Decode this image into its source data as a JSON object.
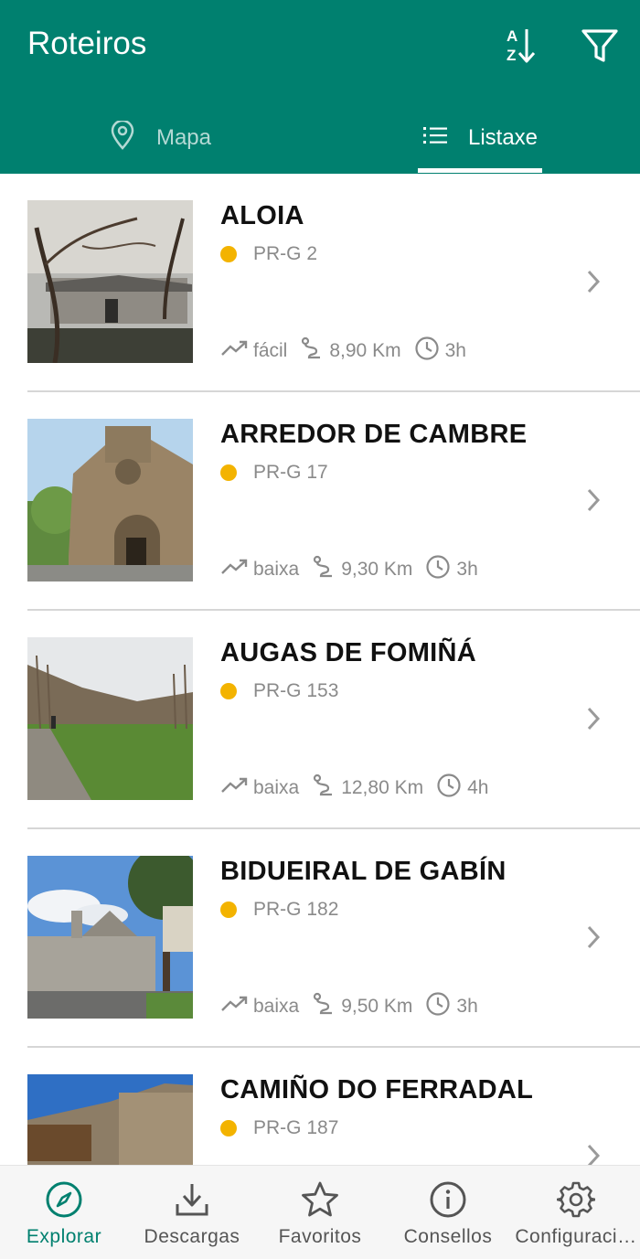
{
  "app": {
    "title": "Roteiros"
  },
  "header": {
    "sort_icon": "sort-alpha-down-icon",
    "filter_icon": "filter-icon"
  },
  "tabs": [
    {
      "label": "Mapa",
      "icon": "map-pin-icon",
      "selected": false
    },
    {
      "label": "Listaxe",
      "icon": "list-icon",
      "selected": true
    }
  ],
  "colors": {
    "primary": "#00806f",
    "status_dot": "#f3b300",
    "muted_text": "#8a8a8a"
  },
  "routes": [
    {
      "name": "ALOIA",
      "code": "PR-G 2",
      "difficulty": "fácil",
      "distance": "8,90 Km",
      "duration": "3h"
    },
    {
      "name": "ARREDOR DE CAMBRE",
      "code": "PR-G 17",
      "difficulty": "baixa",
      "distance": "9,30 Km",
      "duration": "3h"
    },
    {
      "name": "AUGAS DE FOMIÑÁ",
      "code": "PR-G 153",
      "difficulty": "baixa",
      "distance": "12,80 Km",
      "duration": "4h"
    },
    {
      "name": "BIDUEIRAL DE GABÍN",
      "code": "PR-G 182",
      "difficulty": "baixa",
      "distance": "9,50 Km",
      "duration": "3h"
    },
    {
      "name": "CAMIÑO DO FERRADAL",
      "code": "PR-G 187"
    }
  ],
  "bottom_nav": [
    {
      "label": "Explorar",
      "icon": "compass-icon",
      "active": true
    },
    {
      "label": "Descargas",
      "icon": "download-icon",
      "active": false
    },
    {
      "label": "Favoritos",
      "icon": "star-icon",
      "active": false
    },
    {
      "label": "Consellos",
      "icon": "info-icon",
      "active": false
    },
    {
      "label": "Configuraci…",
      "icon": "gear-icon",
      "active": false
    }
  ]
}
